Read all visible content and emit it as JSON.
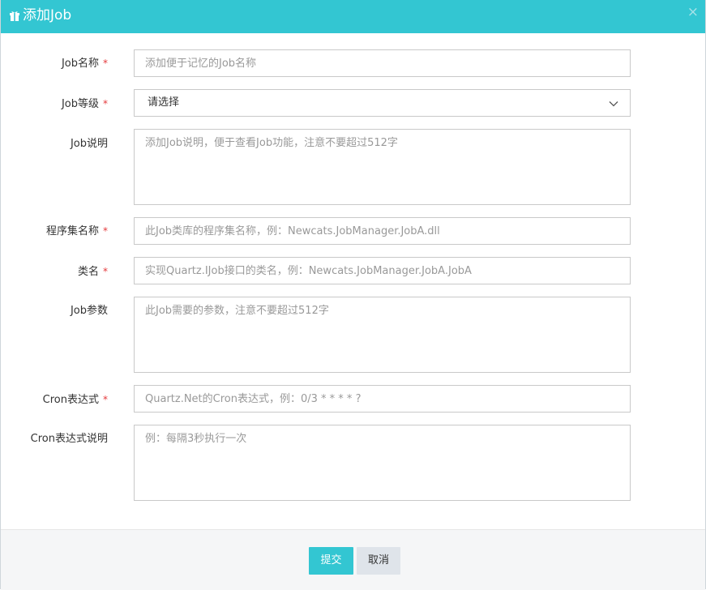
{
  "dialog": {
    "title": "添加Job",
    "close_label": "×"
  },
  "form": {
    "required_mark": "*",
    "job_name": {
      "label": "Job名称",
      "placeholder": "添加便于记忆的Job名称"
    },
    "job_level": {
      "label": "Job等级",
      "selected": "请选择"
    },
    "job_desc": {
      "label": "Job说明",
      "placeholder": "添加Job说明，便于查看Job功能，注意不要超过512字"
    },
    "assembly_name": {
      "label": "程序集名称",
      "placeholder": "此Job类库的程序集名称，例：Newcats.JobManager.JobA.dll"
    },
    "class_name": {
      "label": "类名",
      "placeholder": "实现Quartz.IJob接口的类名，例：Newcats.JobManager.JobA.JobA"
    },
    "job_params": {
      "label": "Job参数",
      "placeholder": "此Job需要的参数，注意不要超过512字"
    },
    "cron": {
      "label": "Cron表达式",
      "placeholder": "Quartz.Net的Cron表达式，例：0/3 * * * * ?"
    },
    "cron_desc": {
      "label": "Cron表达式说明",
      "placeholder": "例：每隔3秒执行一次"
    }
  },
  "footer": {
    "submit_label": "提交",
    "cancel_label": "取消"
  },
  "colors": {
    "accent": "#33c6d2",
    "required": "#e4393c",
    "footer_bg": "#f5f6f7",
    "cancel_bg": "#dfe4ea"
  },
  "icons": {
    "title": "gift-icon",
    "close": "close-icon",
    "select": "chevron-down-icon"
  }
}
